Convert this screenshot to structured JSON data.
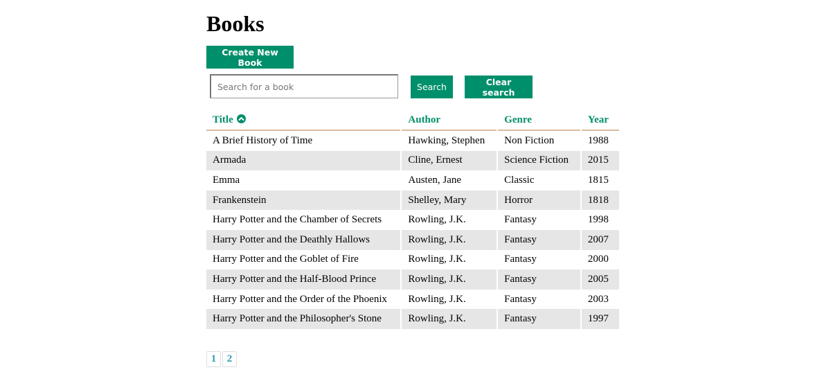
{
  "page": {
    "title": "Books"
  },
  "toolbar": {
    "create_label": "Create New Book",
    "search_placeholder": "Search for a book",
    "search_value": "",
    "search_label": "Search",
    "clear_label": "Clear search"
  },
  "table": {
    "headers": {
      "title": "Title",
      "author": "Author",
      "genre": "Genre",
      "year": "Year"
    },
    "sort_icon": "chevron-up-circle-icon",
    "rows": [
      {
        "title": "A Brief History of Time",
        "author": "Hawking, Stephen",
        "genre": "Non Fiction",
        "year": "1988"
      },
      {
        "title": "Armada",
        "author": "Cline, Ernest",
        "genre": "Science Fiction",
        "year": "2015"
      },
      {
        "title": "Emma",
        "author": "Austen, Jane",
        "genre": "Classic",
        "year": "1815"
      },
      {
        "title": "Frankenstein",
        "author": "Shelley, Mary",
        "genre": "Horror",
        "year": "1818"
      },
      {
        "title": "Harry Potter and the Chamber of Secrets",
        "author": "Rowling, J.K.",
        "genre": "Fantasy",
        "year": "1998"
      },
      {
        "title": "Harry Potter and the Deathly Hallows",
        "author": "Rowling, J.K.",
        "genre": "Fantasy",
        "year": "2007"
      },
      {
        "title": "Harry Potter and the Goblet of Fire",
        "author": "Rowling, J.K.",
        "genre": "Fantasy",
        "year": "2000"
      },
      {
        "title": "Harry Potter and the Half-Blood Prince",
        "author": "Rowling, J.K.",
        "genre": "Fantasy",
        "year": "2005"
      },
      {
        "title": "Harry Potter and the Order of the Phoenix",
        "author": "Rowling, J.K.",
        "genre": "Fantasy",
        "year": "2003"
      },
      {
        "title": "Harry Potter and the Philosopher's Stone",
        "author": "Rowling, J.K.",
        "genre": "Fantasy",
        "year": "1997"
      }
    ]
  },
  "pagination": {
    "pages": [
      "1",
      "2"
    ]
  },
  "colors": {
    "accent": "#008f6b",
    "header_border": "#d9b99b",
    "stripe": "#e6e6e6",
    "page_link": "#2a9fb0"
  }
}
